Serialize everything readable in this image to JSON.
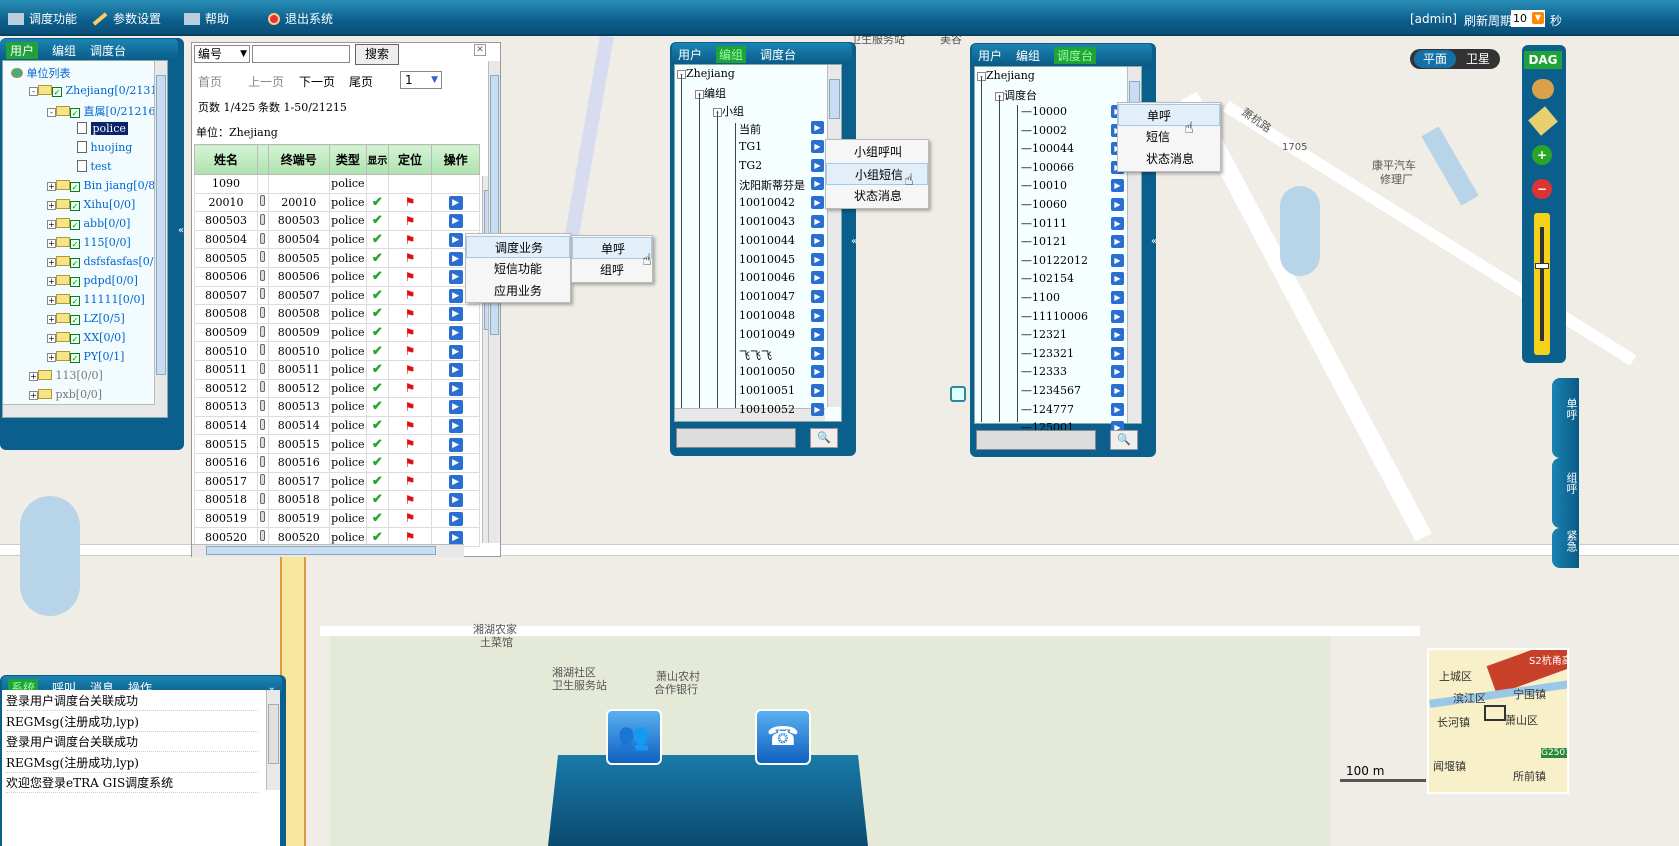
{
  "topbar": {
    "menu": [
      {
        "label": "调度功能",
        "icon": "dispatch-icon"
      },
      {
        "label": "参数设置",
        "icon": "wrench-icon"
      },
      {
        "label": "帮助",
        "icon": "help-icon"
      },
      {
        "label": "退出系统",
        "icon": "exit-icon"
      }
    ],
    "user": "[admin]",
    "refresh_label": "刷新周期",
    "refresh_value": "10",
    "seconds": "秒"
  },
  "left_panel": {
    "tabs": [
      "用户",
      "编组",
      "调度台"
    ],
    "tree": [
      {
        "label": "单位列表"
      },
      {
        "label": "Zhejiang[0/21310"
      },
      {
        "label": "直属[0/21216"
      },
      {
        "label": "police"
      },
      {
        "label": "huojing"
      },
      {
        "label": "test"
      },
      {
        "label": "Bin jiang[0/88"
      },
      {
        "label": "Xihu[0/0]"
      },
      {
        "label": "abb[0/0]"
      },
      {
        "label": "115[0/0]"
      },
      {
        "label": "dsfsfasfas[0/0"
      },
      {
        "label": "pdpd[0/0]"
      },
      {
        "label": "11111[0/0]"
      },
      {
        "label": "LZ[0/5]"
      },
      {
        "label": "XX[0/0]"
      },
      {
        "label": "PY[0/1]"
      },
      {
        "label": "113[0/0]"
      },
      {
        "label": "pxb[0/0]"
      }
    ]
  },
  "grid_panel": {
    "search_field": "编号",
    "search_value": "",
    "search_button": "搜索",
    "pager": {
      "first": "首页",
      "prev": "上一页",
      "next": "下一页",
      "last": "尾页",
      "page_select": "1"
    },
    "page_info": "页数 1/425",
    "count_info": "条数 1-50/21215",
    "unit": "单位：Zhejiang",
    "columns": [
      "姓名",
      "终端号",
      "类型",
      "显示",
      "定位",
      "操作"
    ],
    "rows": [
      [
        "1090",
        "",
        "police"
      ],
      [
        "20010",
        "20010",
        "police"
      ],
      [
        "800503",
        "800503",
        "police"
      ],
      [
        "800504",
        "800504",
        "police"
      ],
      [
        "800505",
        "800505",
        "police"
      ],
      [
        "800506",
        "800506",
        "police"
      ],
      [
        "800507",
        "800507",
        "police"
      ],
      [
        "800508",
        "800508",
        "police"
      ],
      [
        "800509",
        "800509",
        "police"
      ],
      [
        "800510",
        "800510",
        "police"
      ],
      [
        "800511",
        "800511",
        "police"
      ],
      [
        "800512",
        "800512",
        "police"
      ],
      [
        "800513",
        "800513",
        "police"
      ],
      [
        "800514",
        "800514",
        "police"
      ],
      [
        "800515",
        "800515",
        "police"
      ],
      [
        "800516",
        "800516",
        "police"
      ],
      [
        "800517",
        "800517",
        "police"
      ],
      [
        "800518",
        "800518",
        "police"
      ],
      [
        "800519",
        "800519",
        "police"
      ],
      [
        "800520",
        "800520",
        "police"
      ]
    ]
  },
  "grid_ctx": {
    "items": [
      "调度业务",
      "短信功能",
      "应用业务"
    ],
    "sub": [
      "单呼",
      "组呼"
    ]
  },
  "group_panel": {
    "tabs": [
      "用户",
      "编组",
      "调度台"
    ],
    "root": "Zhejiang",
    "node1": "编组",
    "node2": "小组",
    "items": [
      "当前",
      "TG1",
      "TG2",
      "沈阳斯蒂芬是",
      "10010042",
      "10010043",
      "10010044",
      "10010045",
      "10010046",
      "10010047",
      "10010048",
      "10010049",
      "飞飞飞",
      "10010050",
      "10010051",
      "10010052"
    ],
    "ctx": [
      "小组呼叫",
      "小组短信",
      "状态消息"
    ]
  },
  "console_panel": {
    "tabs": [
      "用户",
      "编组",
      "调度台"
    ],
    "root": "Zhejiang",
    "node1": "调度台",
    "items": [
      "10000",
      "10002",
      "100044",
      "100066",
      "10010",
      "10060",
      "10111",
      "10121",
      "10122012",
      "102154",
      "1100",
      "11110006",
      "12321",
      "123321",
      "12333",
      "1234567",
      "124777",
      "125001"
    ],
    "ctx": [
      "单呼",
      "短信",
      "状态消息"
    ]
  },
  "log_panel": {
    "tabs": [
      "系统",
      "呼叫",
      "消息",
      "操作"
    ],
    "lines": [
      "登录用户调度台关联成功",
      "REGMsg(注册成功,lyp)",
      "登录用户调度台关联成功",
      "REGMsg(注册成功,lyp)",
      "欢迎您登录eTRA GIS调度系统"
    ]
  },
  "map": {
    "mode_flat": "平面",
    "mode_sat": "卫星",
    "brand": "DAG",
    "scale": "100 m",
    "labels": [
      "萧杭路",
      "1705",
      "康平汽车",
      "修理厂",
      "湘湖农家",
      "土菜馆",
      "湘湖社区",
      "卫生服务站",
      "萧山农村",
      "合作银行",
      "卫生服务站",
      "美谷"
    ],
    "side_tabs": [
      "单呼",
      "组呼",
      "紧急"
    ],
    "overview": [
      "上城区",
      "滨江区",
      "宁围镇",
      "长河镇",
      "萧山区",
      "闻堰镇",
      "所前镇",
      "G2501",
      "S2杭甬高速"
    ]
  },
  "colors": {
    "bar": "#0c5f8c",
    "accent": "#1fa23a",
    "title_green": "#7eff5a"
  }
}
